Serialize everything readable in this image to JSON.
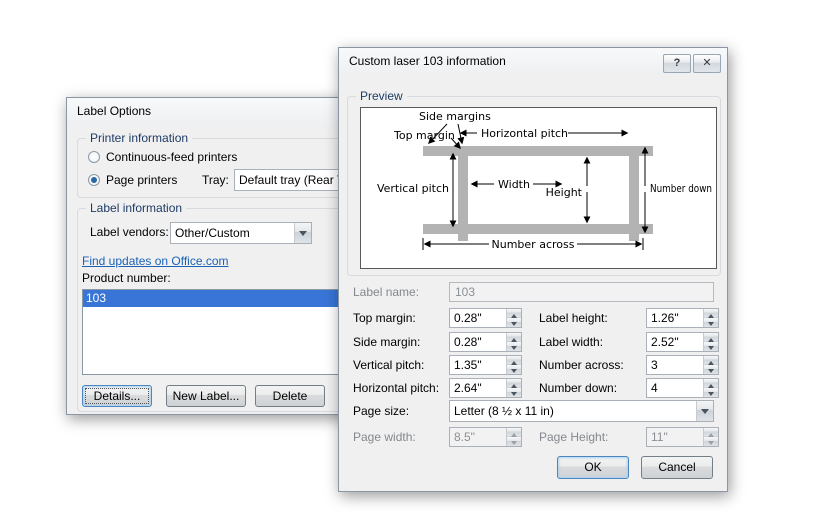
{
  "icons": {
    "help": "?",
    "close": "✕"
  },
  "label_options_dialog": {
    "title": "Label Options",
    "printer_information": {
      "group_label": "Printer information",
      "continuous_feed_label": "Continuous-feed printers",
      "page_printers_label": "Page printers",
      "tray_label": "Tray:",
      "tray_value": "Default tray (Rear T"
    },
    "label_information": {
      "group_label": "Label information",
      "vendors_label": "Label vendors:",
      "vendors_value": "Other/Custom",
      "updates_link": "Find updates on Office.com",
      "product_number_label": "Product number:",
      "product_list": [
        "103"
      ]
    },
    "buttons": {
      "details": "Details...",
      "new_label": "New Label...",
      "delete": "Delete"
    }
  },
  "custom_label_dialog": {
    "title": "Custom laser 103 information",
    "preview": {
      "group_label": "Preview",
      "annotations": {
        "side_margins": "Side margins",
        "top_margin": "Top margin",
        "horizontal_pitch": "Horizontal pitch",
        "vertical_pitch": "Vertical pitch",
        "width": "Width",
        "height": "Height",
        "number_down": "Number down",
        "number_across": "Number across"
      }
    },
    "fields": {
      "label_name": {
        "label": "Label name:",
        "value": "103"
      },
      "top_margin": {
        "label": "Top margin:",
        "value": "0.28\""
      },
      "side_margin": {
        "label": "Side margin:",
        "value": "0.28\""
      },
      "vertical_pitch": {
        "label": "Vertical pitch:",
        "value": "1.35\""
      },
      "horizontal_pitch": {
        "label": "Horizontal pitch:",
        "value": "2.64\""
      },
      "label_height": {
        "label": "Label height:",
        "value": "1.26\""
      },
      "label_width": {
        "label": "Label width:",
        "value": "2.52\""
      },
      "number_across": {
        "label": "Number across:",
        "value": "3"
      },
      "number_down": {
        "label": "Number down:",
        "value": "4"
      },
      "page_size": {
        "label": "Page size:",
        "value": "Letter (8 ½ x 11 in)"
      },
      "page_width": {
        "label": "Page width:",
        "value": "8.5\""
      },
      "page_height": {
        "label": "Page Height:",
        "value": "11\""
      }
    },
    "buttons": {
      "ok": "OK",
      "cancel": "Cancel"
    }
  }
}
